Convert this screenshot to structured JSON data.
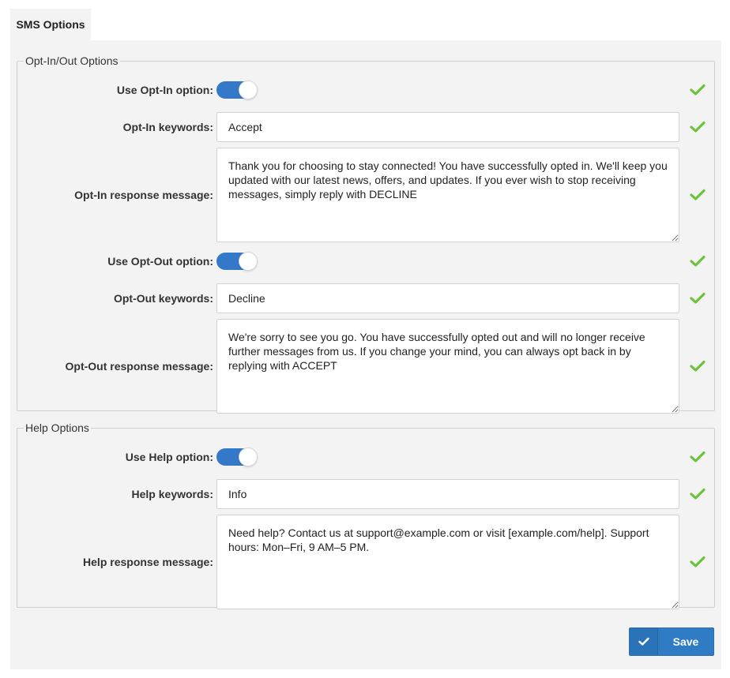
{
  "tab": {
    "label": "SMS Options"
  },
  "optinout": {
    "legend": "Opt-In/Out Options",
    "use_optin_label": "Use Opt-In option:",
    "use_optin_enabled": true,
    "optin_keywords_label": "Opt-In keywords:",
    "optin_keywords_value": "Accept",
    "optin_response_label": "Opt-In response message:",
    "optin_response_value": "Thank you for choosing to stay connected! You have successfully opted in. We'll keep you updated with our latest news, offers, and updates. If you ever wish to stop receiving messages, simply reply with DECLINE",
    "use_optout_label": "Use Opt-Out option:",
    "use_optout_enabled": true,
    "optout_keywords_label": "Opt-Out keywords:",
    "optout_keywords_value": "Decline",
    "optout_response_label": "Opt-Out response message:",
    "optout_response_value": "We're sorry to see you go. You have successfully opted out and will no longer receive further messages from us. If you change your mind, you can always opt back in by replying with ACCEPT"
  },
  "help": {
    "legend": "Help Options",
    "use_help_label": "Use Help option:",
    "use_help_enabled": true,
    "help_keywords_label": "Help keywords:",
    "help_keywords_value": "Info",
    "help_response_label": "Help response message:",
    "help_response_value": "Need help? Contact us at support@example.com or visit [example.com/help]. Support hours: Mon–Fri, 9 AM–5 PM."
  },
  "actions": {
    "save_label": "Save"
  },
  "colors": {
    "accent": "#2f7bc4",
    "toggle_on": "#3478c9",
    "valid_check": "#6cc23a",
    "panel_bg": "#f3f3f3"
  },
  "icons": {
    "valid": "check-icon",
    "save": "check-icon"
  }
}
